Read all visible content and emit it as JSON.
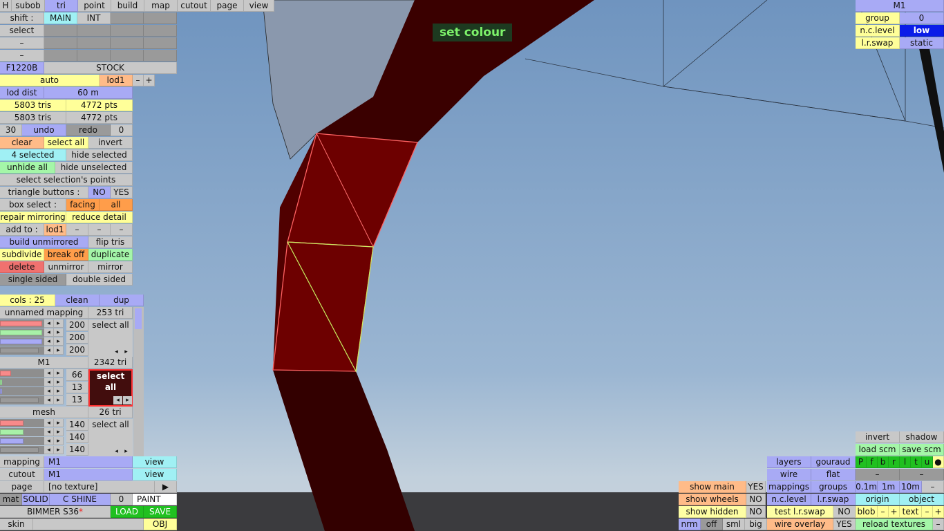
{
  "viewport": {
    "toast": "set colour",
    "mesh_color": "#6b0000",
    "selected_edge": "#ff6060",
    "active_edge": "#c8f060"
  },
  "topbar": {
    "h": "H",
    "subob": "subob",
    "tri": "tri",
    "point": "point",
    "build": "build",
    "map": "map",
    "cutout": "cutout",
    "page": "page",
    "view": "view"
  },
  "shift": {
    "label": "shift :",
    "main": "MAIN",
    "int": "INT"
  },
  "select_row": {
    "label": "select"
  },
  "dash": "–",
  "car": {
    "code": "F1220B",
    "stock": "STOCK",
    "auto": "auto",
    "lod": "lod1",
    "minus": "–",
    "plus": "+"
  },
  "lod": {
    "label": "lod dist",
    "value": "60 m"
  },
  "counts": {
    "tris1": "5803 tris",
    "pts1": "4772 pts",
    "tris2": "5803 tris",
    "pts2": "4772 pts"
  },
  "history": {
    "n": "30",
    "undo": "undo",
    "redo": "redo",
    "z": "0"
  },
  "sel": {
    "clear": "clear",
    "select_all": "select all",
    "invert": "invert",
    "selected": "4 selected",
    "hide_selected": "hide selected",
    "unhide_all": "unhide all",
    "hide_unselected": "hide unselected",
    "select_points": "select selection's points"
  },
  "tribtn": {
    "label": "triangle buttons :",
    "no": "NO",
    "yes": "YES"
  },
  "box": {
    "label": "box select :",
    "facing": "facing",
    "all": "all"
  },
  "ops": {
    "repair": "repair mirroring",
    "reduce": "reduce detail",
    "add_to": "add to :",
    "lod1": "lod1",
    "build_unmirrored": "build unmirrored",
    "flip": "flip tris",
    "subdivide": "subdivide",
    "break_off": "break off",
    "duplicate": "duplicate",
    "delete": "delete",
    "unmirror": "unmirror",
    "mirror": "mirror",
    "single": "single sided",
    "double": "double sided"
  },
  "cols": {
    "label": "cols : 25",
    "clean": "clean",
    "dup": "dup"
  },
  "materials": [
    {
      "name": "unnamed mapping",
      "tri": "253 tri",
      "r": "200",
      "g": "200",
      "b": "200",
      "sel": "select all",
      "r_f": 0.98,
      "g_f": 0.98,
      "b_f": 0.98,
      "swatch": "#c0c0c0",
      "active": false
    },
    {
      "name": "M1",
      "tri": "2342 tri",
      "r": "66",
      "g": "13",
      "b": "13",
      "sel": "select all",
      "r_f": 0.26,
      "g_f": 0.05,
      "b_f": 0.05,
      "swatch": "#420d0d",
      "active": true
    },
    {
      "name": "mesh",
      "tri": "26 tri",
      "r": "140",
      "g": "140",
      "b": "140",
      "sel": "select all",
      "r_f": 0.55,
      "g_f": 0.55,
      "b_f": 0.55,
      "swatch": "#8c8c8c",
      "active": false
    }
  ],
  "arrows": {
    "left": "◂",
    "right": "▸",
    "play": "▶"
  },
  "bottom_left": {
    "mapping": "mapping",
    "mapping_val": "M1",
    "view": "view",
    "cutout": "cutout",
    "cutout_val": "M1",
    "page": "page",
    "page_val": "[no texture]",
    "mat": "mat",
    "solid": "SOLID",
    "cshine": "C SHINE",
    "zero": "0",
    "paint": "PAINT",
    "car_name": "BIMMER S36",
    "asterisk": "*",
    "load": "LOAD",
    "save": "SAVE",
    "skin": "skin",
    "obj": "OBJ"
  },
  "right_top": {
    "m1": "M1",
    "group": "group",
    "group_val": "0",
    "nclevel": "n.c.level",
    "nclevel_val": "low",
    "lrswap": "l.r.swap",
    "lrswap_val": "static"
  },
  "bottom_right": {
    "invert": "invert",
    "shadow": "shadow",
    "load_scm": "load scm",
    "save_scm": "save scm",
    "layers": "layers",
    "gouraud": "gouraud",
    "letters": [
      "P",
      "f",
      "b",
      "r",
      "l",
      "t",
      "u"
    ],
    "dot": "●",
    "wire": "wire",
    "flat": "flat",
    "mappings": "mappings",
    "groups": "groups",
    "d01": "0.1m",
    "d1": "1m",
    "d10": "10m",
    "nclevel": "n.c.level",
    "lrswap": "l.r.swap",
    "origin": "origin",
    "object": "object",
    "test_lr": "test l.r.swap",
    "no": "NO",
    "yes": "YES",
    "blob": "blob",
    "text": "text",
    "plus": "+",
    "wire_overlay": "wire overlay",
    "reload": "reload textures",
    "show_main": "show main",
    "show_wheels": "show wheels",
    "show_hidden": "show hidden",
    "nrm": "nrm",
    "off": "off",
    "sml": "sml",
    "big": "big"
  }
}
